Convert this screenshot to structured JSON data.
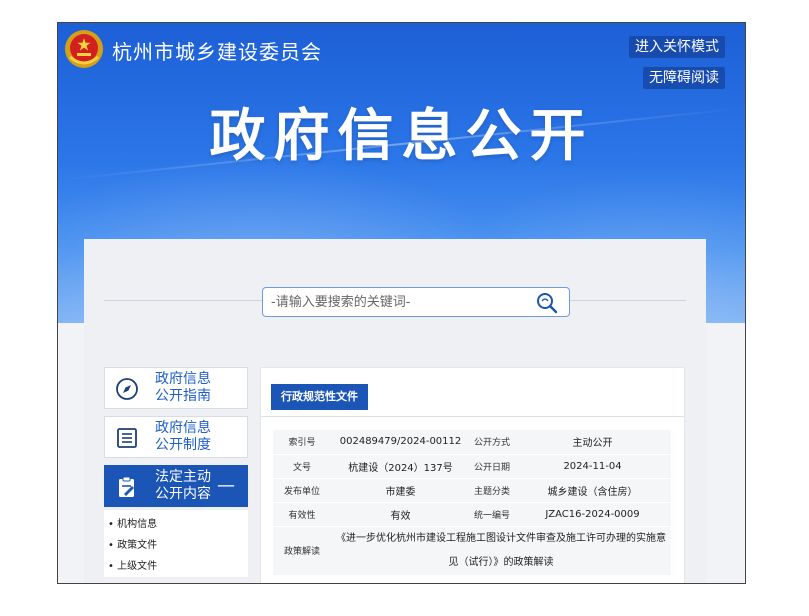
{
  "header": {
    "site_name": "杭州市城乡建设委员会",
    "care_mode": "进入关怀模式",
    "accessible": "无障碍阅读",
    "hero_title": "政府信息公开"
  },
  "search": {
    "placeholder": "-请输入要搜索的关键词-"
  },
  "sidebar": {
    "items": [
      {
        "line1": "政府信息",
        "line2": "公开指南",
        "icon": "compass-icon"
      },
      {
        "line1": "政府信息",
        "line2": "公开制度",
        "icon": "document-list-icon"
      },
      {
        "line1": "法定主动",
        "line2": "公开内容",
        "icon": "clipboard-edit-icon",
        "toggle": "—"
      }
    ],
    "subitems": [
      "• 机构信息",
      "• 政策文件",
      "• 上级文件"
    ]
  },
  "main": {
    "tab": "行政规范性文件",
    "meta": {
      "index_label": "索引号",
      "index_value": "002489479/2024-00112",
      "mode_label": "公开方式",
      "mode_value": "主动公开",
      "docno_label": "文号",
      "docno_value": "杭建设（2024）137号",
      "date_label": "公开日期",
      "date_value": "2024-11-04",
      "org_label": "发布单位",
      "org_value": "市建委",
      "topic_label": "主题分类",
      "topic_value": "城乡建设（含住房）",
      "valid_label": "有效性",
      "valid_value": "有效",
      "code_label": "统一编号",
      "code_value": "JZAC16-2024-0009",
      "interp_label": "政策解读",
      "interp_value": "《进一步优化杭州市建设工程施工图设计文件审查及施工许可办理的实施意见（试行）》的政策解读"
    }
  },
  "colors": {
    "banner": "#2b76e8",
    "accent": "#1b55b5",
    "link": "#1d5fc7"
  }
}
